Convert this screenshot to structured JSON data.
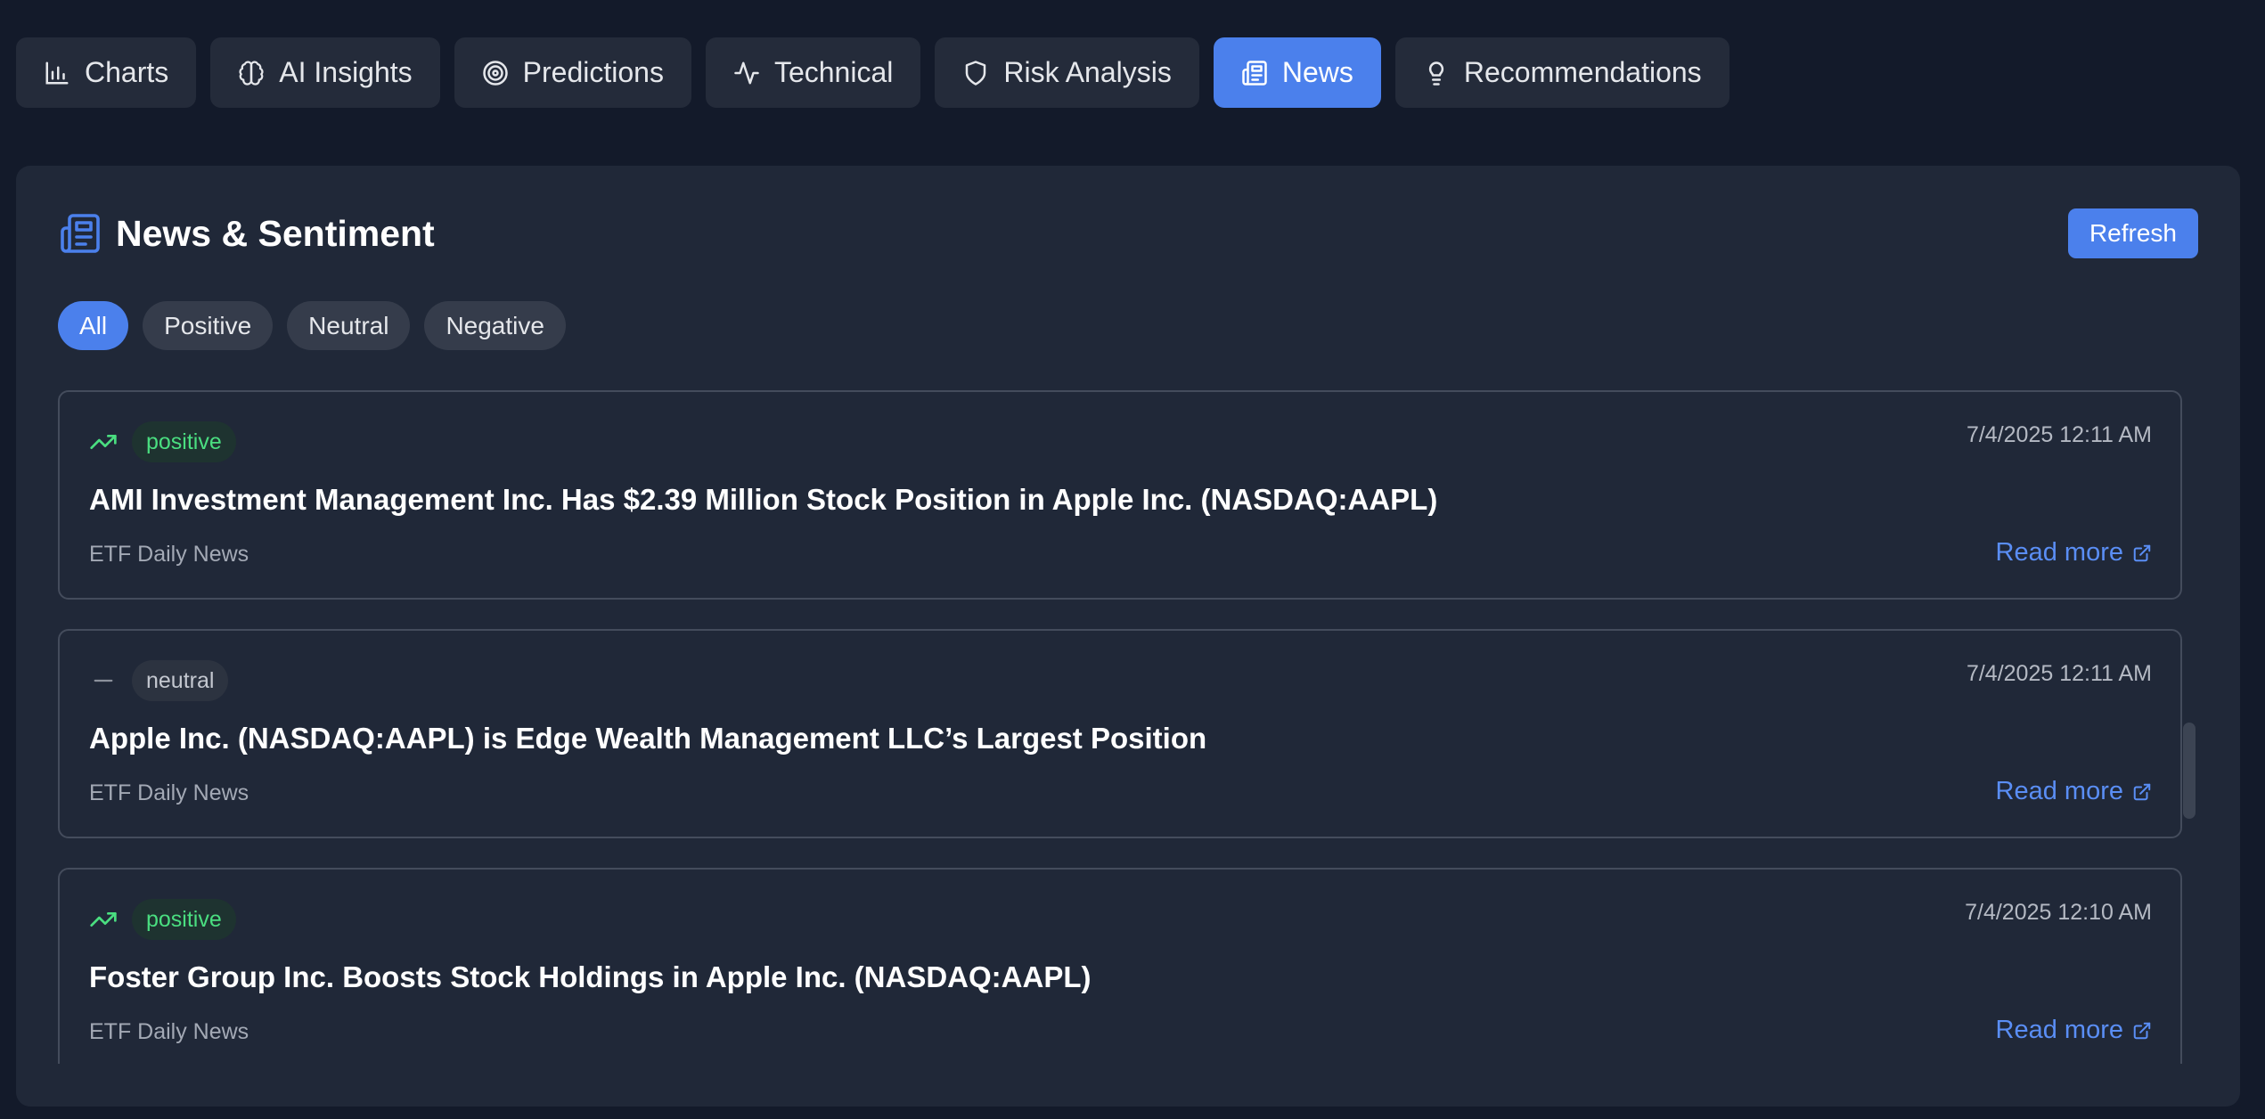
{
  "tabs": [
    {
      "label": "Charts",
      "icon": "bar-chart-icon"
    },
    {
      "label": "AI Insights",
      "icon": "brain-icon"
    },
    {
      "label": "Predictions",
      "icon": "target-icon"
    },
    {
      "label": "Technical",
      "icon": "activity-icon"
    },
    {
      "label": "Risk Analysis",
      "icon": "shield-icon"
    },
    {
      "label": "News",
      "icon": "newspaper-icon",
      "active": true
    },
    {
      "label": "Recommendations",
      "icon": "lightbulb-icon"
    }
  ],
  "panel": {
    "title": "News & Sentiment",
    "title_icon": "newspaper-icon",
    "refresh_label": "Refresh"
  },
  "filters": [
    {
      "label": "All",
      "active": true
    },
    {
      "label": "Positive"
    },
    {
      "label": "Neutral"
    },
    {
      "label": "Negative"
    }
  ],
  "news": [
    {
      "sentiment": "positive",
      "sentiment_icon": "trending-up-icon",
      "date": "7/4/2025 12:11 AM",
      "headline": "AMI Investment Management Inc. Has $2.39 Million Stock Position in Apple Inc. (NASDAQ:AAPL)",
      "source": "ETF Daily News",
      "read_more": "Read more"
    },
    {
      "sentiment": "neutral",
      "sentiment_icon": "minus-icon",
      "date": "7/4/2025 12:11 AM",
      "headline": "Apple Inc. (NASDAQ:AAPL) is Edge Wealth Management LLC’s Largest Position",
      "source": "ETF Daily News",
      "read_more": "Read more"
    },
    {
      "sentiment": "positive",
      "sentiment_icon": "trending-up-icon",
      "date": "7/4/2025 12:10 AM",
      "headline": "Foster Group Inc. Boosts Stock Holdings in Apple Inc. (NASDAQ:AAPL)",
      "source": "ETF Daily News",
      "read_more": "Read more"
    }
  ],
  "colors": {
    "accent": "#4b80ec",
    "positive": "#4ade80",
    "link": "#5a8ef5",
    "background": "#131a2a",
    "panel": "#202838"
  }
}
